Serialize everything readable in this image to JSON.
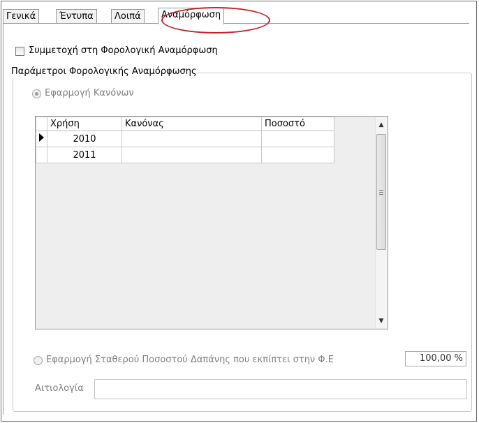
{
  "tabs": [
    {
      "label": "Γενικά"
    },
    {
      "label": "Έντυπα"
    },
    {
      "label": "Λοιπά"
    },
    {
      "label": "Αναμόρφωση",
      "active": true
    }
  ],
  "participate": {
    "label": "Συμμετοχή στη Φορολογική Αναμόρφωση",
    "checked": false
  },
  "group": {
    "title": "Παράμετροι Φορολογικής Αναμόρφωσης"
  },
  "rules_option": {
    "label": "Εφαρμογή Κανόνων",
    "selected": true,
    "enabled": false
  },
  "grid": {
    "columns": [
      "Χρήση",
      "Κανόνας",
      "Ποσοστό"
    ],
    "rows": [
      {
        "year": "2010",
        "rule": "",
        "percent": "",
        "current": true
      },
      {
        "year": "2011",
        "rule": "",
        "percent": "",
        "current": false
      }
    ]
  },
  "fixed_option": {
    "label": "Εφαρμογή Σταθερού Ποσοστού Δαπάνης που εκπίπτει στην Φ.Ε",
    "selected": false,
    "enabled": false
  },
  "fixed_percent": {
    "value": "100,00 %"
  },
  "explanation": {
    "label": "Αιτιολογία",
    "value": ""
  },
  "colors": {
    "highlight": "#c8202a",
    "disabled_text": "#808080"
  }
}
